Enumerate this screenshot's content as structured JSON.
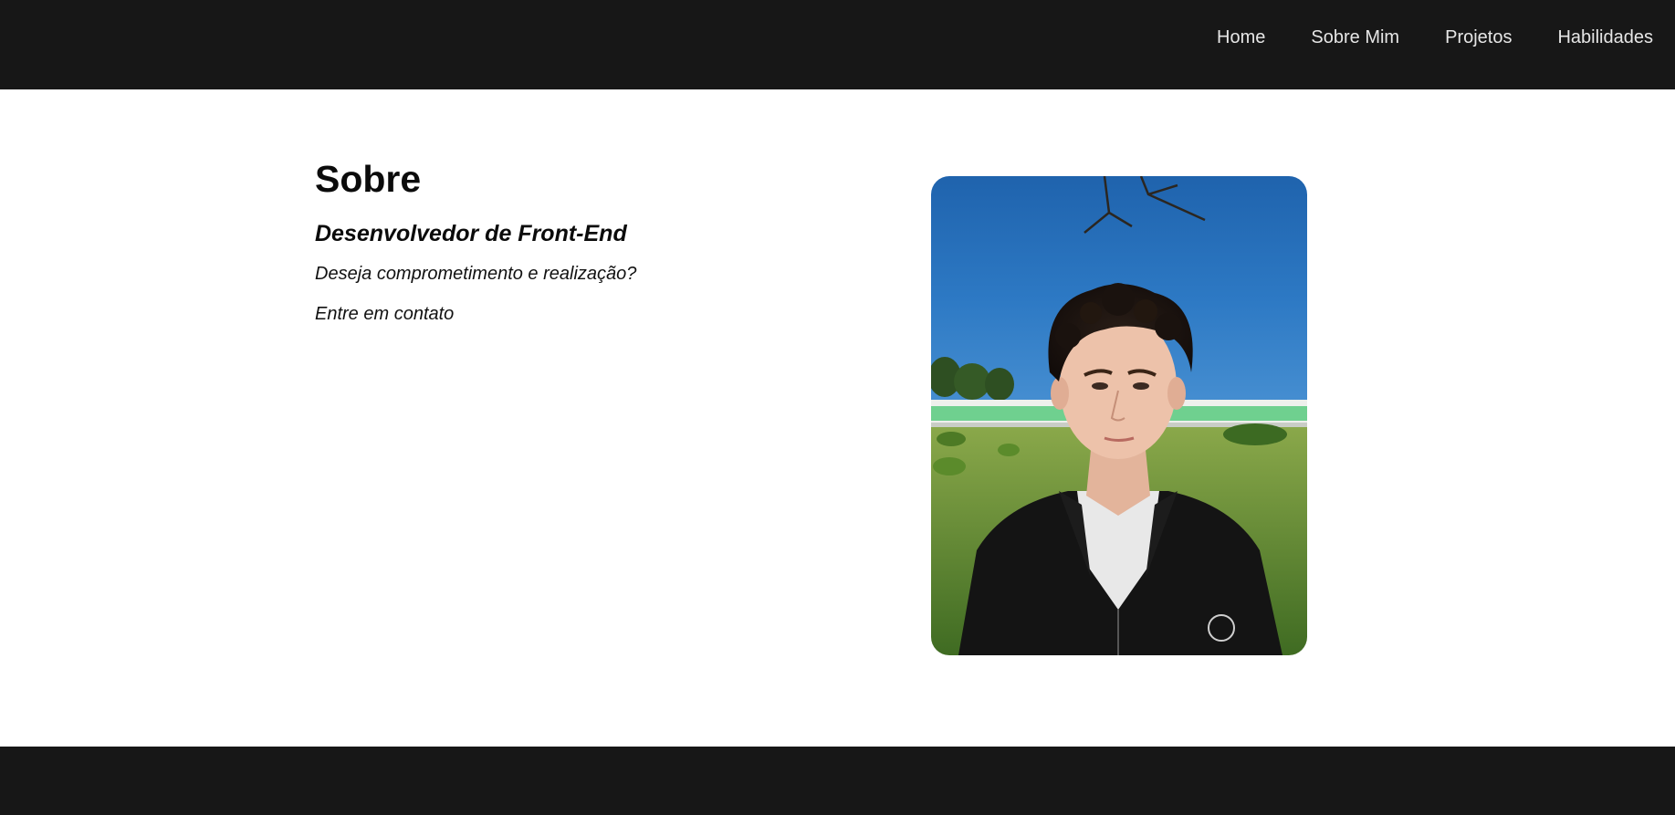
{
  "nav": {
    "items": [
      {
        "label": "Home"
      },
      {
        "label": "Sobre Mim"
      },
      {
        "label": "Projetos"
      },
      {
        "label": "Habilidades"
      }
    ]
  },
  "about": {
    "title": "Sobre",
    "role": "Desenvolvedor de Front-End",
    "line1": "Deseja comprometimento e realização?",
    "line2": "Entre em contato"
  },
  "colors": {
    "header_bg": "#171717",
    "footer_bg": "#171717",
    "page_bg": "#ffffff",
    "nav_text": "#e6e6e6"
  }
}
